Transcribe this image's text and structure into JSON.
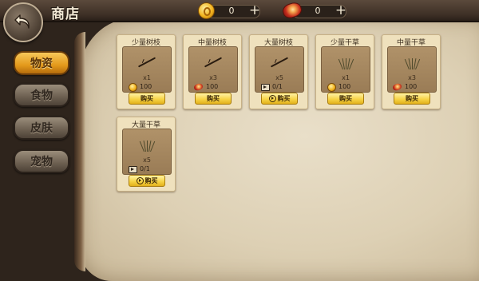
{
  "header": {
    "title": "商店"
  },
  "currencies": [
    {
      "icon": "gold-coin-icon",
      "value": "0",
      "add_label": "+"
    },
    {
      "icon": "red-gem-icon",
      "value": "0",
      "add_label": "+"
    }
  ],
  "tabs": [
    {
      "label": "物资",
      "active": true
    },
    {
      "label": "食物",
      "active": false
    },
    {
      "label": "皮肤",
      "active": false
    },
    {
      "label": "宠物",
      "active": false
    }
  ],
  "items": [
    {
      "name": "少量树枝",
      "art": "twig",
      "qty": "x1",
      "price_type": "coin",
      "price": "100",
      "buy_label": "购买",
      "buy_icon": ""
    },
    {
      "name": "中量树枝",
      "art": "twig",
      "qty": "x3",
      "price_type": "gem",
      "price": "100",
      "buy_label": "购买",
      "buy_icon": ""
    },
    {
      "name": "大量树枝",
      "art": "twig",
      "qty": "x5",
      "price_type": "ad",
      "price": "0/1",
      "buy_label": "购买",
      "buy_icon": "play-circle-icon"
    },
    {
      "name": "少量干草",
      "art": "hay",
      "qty": "x1",
      "price_type": "coin",
      "price": "100",
      "buy_label": "购买",
      "buy_icon": ""
    },
    {
      "name": "中量干草",
      "art": "hay",
      "qty": "x3",
      "price_type": "gem",
      "price": "100",
      "buy_label": "购买",
      "buy_icon": ""
    },
    {
      "name": "大量干草",
      "art": "hay",
      "qty": "x5",
      "price_type": "ad",
      "price": "0/1",
      "buy_label": "购买",
      "buy_icon": "play-circle-icon"
    }
  ]
}
